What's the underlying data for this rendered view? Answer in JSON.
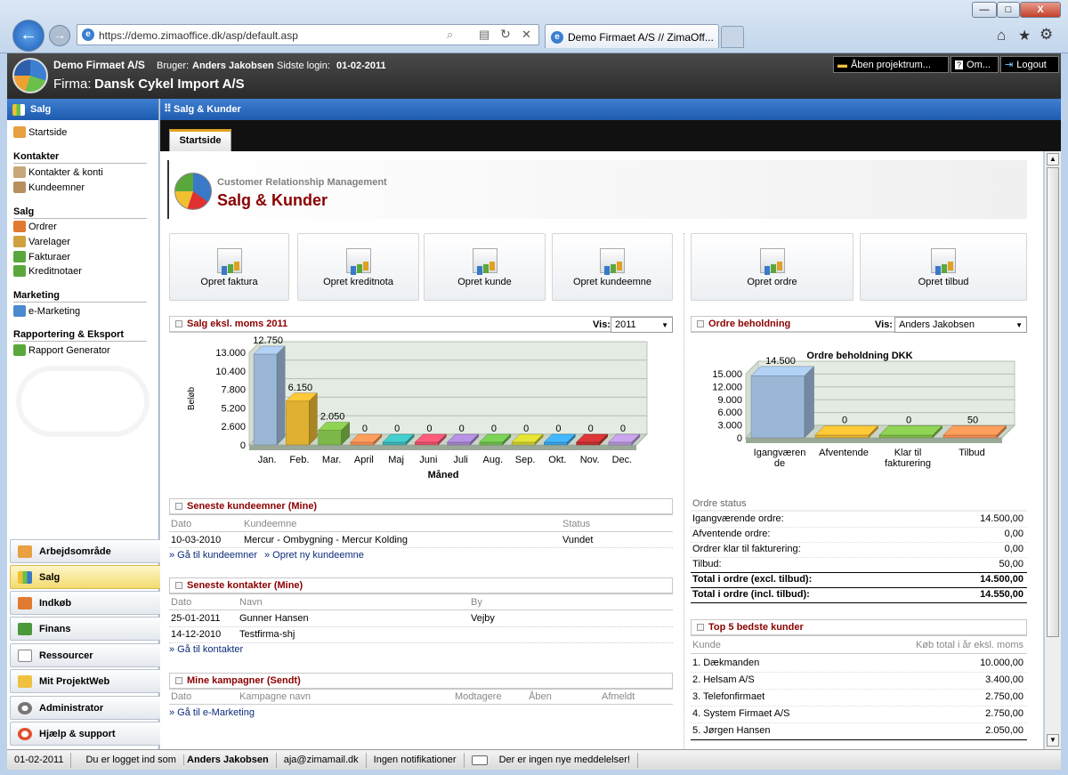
{
  "browser": {
    "url": "https://demo.zimaoffice.dk/asp/default.asp",
    "tab_title": "Demo Firmaet A/S // ZimaOff...",
    "win_min": "—",
    "win_max": "□",
    "win_close": "X"
  },
  "header": {
    "company": "Demo Firmaet A/S",
    "user_label": "Bruger:",
    "user": "Anders Jakobsen",
    "login_label": "Sidste login:",
    "login_date": "01-02-2011",
    "firma_label": "Firma:",
    "firma": "Dansk Cykel Import A/S",
    "btn_project": "Åben projektrum...",
    "btn_about": "Om...",
    "btn_logout": "Logout"
  },
  "sidebar": {
    "title": "Salg",
    "start": "Startside",
    "sections": [
      {
        "title": "Kontakter",
        "items": [
          "Kontakter & konti",
          "Kundeemner"
        ]
      },
      {
        "title": "Salg",
        "items": [
          "Ordrer",
          "Varelager",
          "Fakturaer",
          "Kreditnotaer"
        ]
      },
      {
        "title": "Marketing",
        "items": [
          "e-Marketing"
        ]
      },
      {
        "title": "Rapportering & Eksport",
        "items": [
          "Rapport Generator"
        ]
      }
    ],
    "modules": [
      "Arbejdsområde",
      "Salg",
      "Indkøb",
      "Finans",
      "Ressourcer",
      "Mit ProjektWeb",
      "Administrator",
      "Hjælp & support"
    ]
  },
  "content": {
    "topbar": "Salg & Kunder",
    "tab": "Startside",
    "crm_sub": "Customer Relationship Management",
    "crm_title": "Salg & Kunder",
    "tiles": [
      "Opret faktura",
      "Opret kreditnota",
      "Opret kunde",
      "Opret kundeemne",
      "Opret ordre",
      "Opret tilbud"
    ]
  },
  "sales_panel": {
    "title": "Salg eksl. moms 2011",
    "vis_label": "Vis:",
    "vis_value": "2011"
  },
  "orders_panel": {
    "title": "Ordre beholdning",
    "vis_label": "Vis:",
    "vis_value": "Anders Jakobsen"
  },
  "chart_data": [
    {
      "type": "bar",
      "title": "",
      "xlabel": "Måned",
      "ylabel": "Beløb",
      "ylim": [
        0,
        13000
      ],
      "yticks": [
        "13.000",
        "10.400",
        "7.800",
        "5.200",
        "2.600",
        "0"
      ],
      "categories": [
        "Jan.",
        "Feb.",
        "Mar.",
        "April",
        "Maj",
        "Juni",
        "Juli",
        "Aug.",
        "Sep.",
        "Okt.",
        "Nov.",
        "Dec."
      ],
      "values": [
        12750,
        6150,
        2050,
        0,
        0,
        0,
        0,
        0,
        0,
        0,
        0,
        0
      ],
      "labels": [
        "12.750",
        "6.150",
        "2.050",
        "0",
        "0",
        "0",
        "0",
        "0",
        "0",
        "0",
        "0",
        "0"
      ],
      "colors": [
        "#9bb7d6",
        "#e0b030",
        "#7cb848",
        "#f08a50",
        "#3bb3b3",
        "#e0506a",
        "#a080c8",
        "#6cb84c",
        "#c8c830",
        "#3aa0e0",
        "#c03030",
        "#b090d0"
      ]
    },
    {
      "type": "bar",
      "title": "Ordre beholdning DKK",
      "ylim": [
        0,
        15000
      ],
      "yticks": [
        "15.000",
        "12.000",
        "9.000",
        "6.000",
        "3.000",
        "0"
      ],
      "categories": [
        "Igangværende",
        "Afventende",
        "Klar til fakturering",
        "Tilbud"
      ],
      "values": [
        14500,
        0,
        0,
        50
      ],
      "labels": [
        "14.500",
        "0",
        "0",
        "50"
      ],
      "colors": [
        "#9bb7d6",
        "#e0b030",
        "#7cb848",
        "#f08a50"
      ]
    }
  ],
  "leads": {
    "title": "Seneste kundeemner (Mine)",
    "cols": [
      "Dato",
      "Kundeemne",
      "Status"
    ],
    "rows": [
      [
        "10-03-2010",
        "Mercur - Ombygning - Mercur Kolding",
        "Vundet"
      ]
    ],
    "link1": "» Gå til kundeemner",
    "link2": "» Opret ny kundeemne"
  },
  "contacts": {
    "title": "Seneste kontakter (Mine)",
    "cols": [
      "Dato",
      "Navn",
      "By"
    ],
    "rows": [
      [
        "25-01-2011",
        "Gunner Hansen",
        "Vejby"
      ],
      [
        "14-12-2010",
        "Testfirma-shj",
        ""
      ]
    ],
    "link": "» Gå til kontakter"
  },
  "campaigns": {
    "title": "Mine kampagner (Sendt)",
    "cols": [
      "Dato",
      "Kampagne navn",
      "Modtagere",
      "Åben",
      "Afmeldt"
    ],
    "link": "» Gå til e-Marketing"
  },
  "order_status": {
    "title": "Ordre status",
    "rows": [
      [
        "Igangværende ordre:",
        "14.500,00"
      ],
      [
        "Afventende ordre:",
        "0,00"
      ],
      [
        "Ordrer klar til fakturering:",
        "0,00"
      ],
      [
        "Tilbud:",
        "50,00"
      ]
    ],
    "total1": [
      "Total i ordre (excl. tilbud):",
      "14.500,00"
    ],
    "total2": [
      "Total i ordre (incl. tilbud):",
      "14.550,00"
    ]
  },
  "top5": {
    "title": "Top 5 bedste kunder",
    "col1": "Kunde",
    "col2": "Køb total i år eksl. moms",
    "rows": [
      [
        "1. Dækmanden",
        "10.000,00"
      ],
      [
        "2. Helsam A/S",
        "3.400,00"
      ],
      [
        "3. Telefonfirmaet",
        "2.750,00"
      ],
      [
        "4. System Firmaet A/S",
        "2.750,00"
      ],
      [
        "5. Jørgen Hansen",
        "2.050,00"
      ]
    ]
  },
  "status": {
    "date": "01-02-2011",
    "logged_in_prefix": "Du er logget ind som",
    "logged_in_user": "Anders Jakobsen",
    "email": "aja@zimamail.dk",
    "notifications": "Ingen notifikationer",
    "messages": "Der er ingen nye meddelelser!"
  }
}
